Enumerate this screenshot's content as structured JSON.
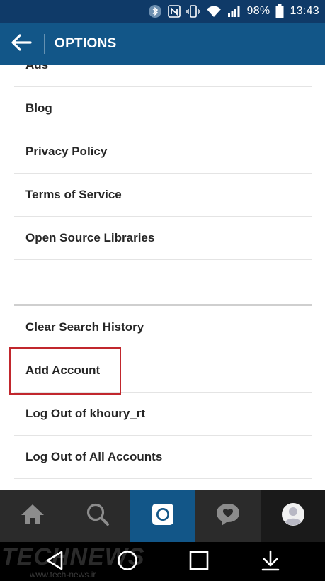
{
  "status_bar": {
    "battery": "98%",
    "time": "13:43",
    "icons": [
      "bluetooth-icon",
      "nfc-icon",
      "vibrate-icon",
      "wifi-icon",
      "signal-icon",
      "battery-icon"
    ]
  },
  "app_bar": {
    "title": "OPTIONS",
    "back_icon": "back-arrow-icon"
  },
  "list": {
    "section1": [
      {
        "label": "Ads"
      },
      {
        "label": "Blog"
      },
      {
        "label": "Privacy Policy"
      },
      {
        "label": "Terms of Service"
      },
      {
        "label": "Open Source Libraries"
      }
    ],
    "section2": [
      {
        "label": "Clear Search History"
      },
      {
        "label": "Add Account"
      },
      {
        "label": "Log Out of khoury_rt"
      },
      {
        "label": "Log Out of All Accounts"
      }
    ]
  },
  "tab_bar": {
    "tabs": [
      "home-icon",
      "search-icon",
      "camera-icon",
      "activity-icon",
      "profile-icon"
    ],
    "active": "camera-icon"
  },
  "system_nav": {
    "buttons": [
      "back-triangle-icon",
      "home-circle-icon",
      "recents-square-icon",
      "notification-down-icon"
    ]
  },
  "watermark": {
    "text": "TECHNEWS",
    "url": "www.tech-news.ir"
  },
  "colors": {
    "app_bar": "#125688",
    "status_bar": "#0f3a68",
    "highlight": "#c1272d",
    "tab_bar": "#2b2b2b"
  }
}
